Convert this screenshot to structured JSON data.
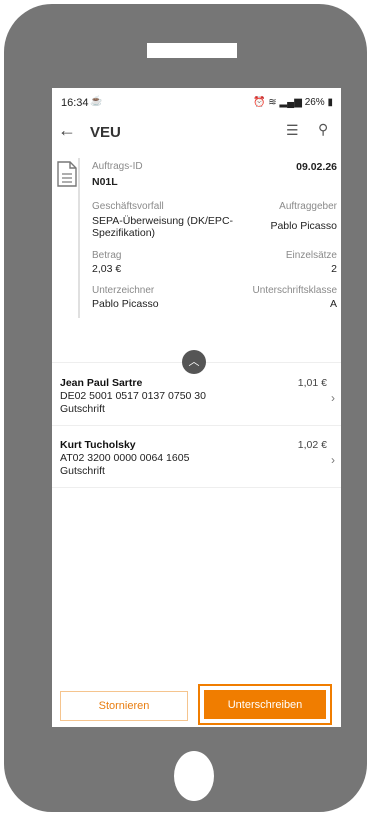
{
  "status_bar": {
    "time": "16:34",
    "battery": "26%"
  },
  "app_bar": {
    "title": "VEU"
  },
  "order": {
    "id_label": "Auftrags-ID",
    "id_value": "N01L",
    "date": "09.02.26",
    "business_label": "Geschäftsvorfall",
    "business_value_line1": "SEPA-Überweisung (DK/EPC-",
    "business_value_line2": "Spezifikation)",
    "principal_label": "Auftraggeber",
    "principal_value": "Pablo Picasso",
    "amount_label": "Betrag",
    "amount_value": "2,03 €",
    "items_label": "Einzelsätze",
    "items_value": "2",
    "signer_label": "Unterzeichner",
    "signer_value": "Pablo Picasso",
    "sigclass_label": "Unterschriftsklasse",
    "sigclass_value": "A"
  },
  "transactions": [
    {
      "name": "Jean Paul Sartre",
      "iban": "DE02 5001 0517 0137 0750 30",
      "type": "Gutschrift",
      "amount": "1,01 €"
    },
    {
      "name": "Kurt Tucholsky",
      "iban": "AT02 3200 0000 0064 1605",
      "type": "Gutschrift",
      "amount": "1,02 €"
    }
  ],
  "buttons": {
    "cancel": "Stornieren",
    "sign": "Unterschreiben"
  },
  "colors": {
    "accent": "#f07d00",
    "device": "#767676"
  }
}
